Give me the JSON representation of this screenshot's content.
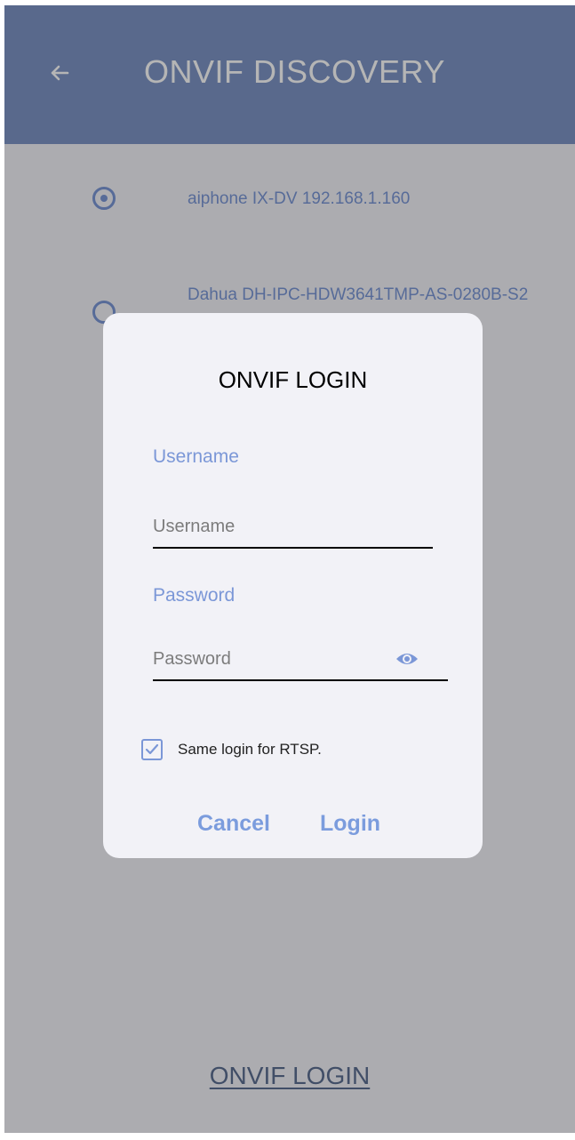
{
  "header": {
    "title": "ONVIF DISCOVERY",
    "back_icon": "arrow-left-icon"
  },
  "devices": [
    {
      "label": "aiphone IX-DV 192.168.1.160",
      "selected": true
    },
    {
      "label": "Dahua DH-IPC-HDW3641TMP-AS-0280B-S2",
      "selected": false
    }
  ],
  "footer": {
    "link_label": "ONVIF LOGIN"
  },
  "dialog": {
    "title": "ONVIF LOGIN",
    "username": {
      "label": "Username",
      "placeholder": "Username",
      "value": ""
    },
    "password": {
      "label": "Password",
      "placeholder": "Password",
      "value": "",
      "toggle_icon": "eye-icon"
    },
    "same_login": {
      "label": "Same login for RTSP.",
      "checked": true
    },
    "cancel_label": "Cancel",
    "login_label": "Login"
  },
  "colors": {
    "accent": "#7b97d7",
    "header": "#7e95c5",
    "footer_link": "#5c6f92"
  }
}
